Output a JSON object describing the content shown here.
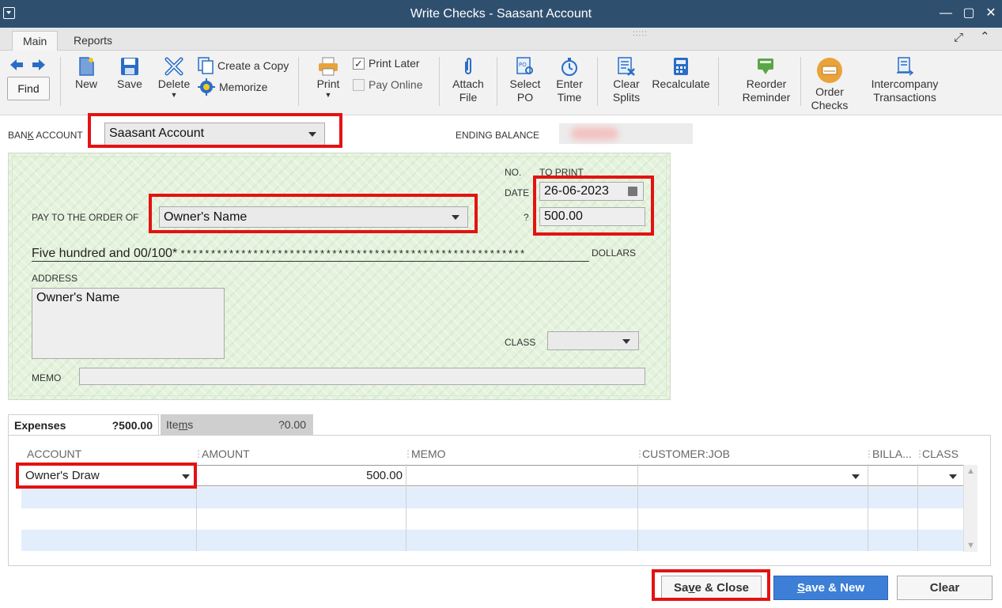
{
  "window": {
    "title": "Write Checks - Saasant Account"
  },
  "tabs": [
    {
      "label": "Main"
    },
    {
      "label": "Reports"
    }
  ],
  "toolbar": {
    "find": "Find",
    "new": "New",
    "save": "Save",
    "delete": "Delete",
    "create_copy": "Create a Copy",
    "memorize": "Memorize",
    "print": "Print",
    "print_later": "Print Later",
    "pay_online": "Pay Online",
    "attach_file": [
      "Attach",
      "File"
    ],
    "select_po": [
      "Select",
      "PO"
    ],
    "enter_time": [
      "Enter",
      "Time"
    ],
    "clear_splits": [
      "Clear",
      "Splits"
    ],
    "recalculate": "Recalculate",
    "reorder_reminder": [
      "Reorder",
      "Reminder"
    ],
    "order_checks": [
      "Order",
      "Checks"
    ],
    "intercompany": [
      "Intercompany",
      "Transactions"
    ]
  },
  "header": {
    "bank_account_label_pre": "BAN",
    "bank_account_label_k": "K",
    "bank_account_label_post": " ACCOUNT",
    "bank_account_value": "Saasant Account",
    "ending_balance_label": "ENDING BALANCE"
  },
  "check": {
    "no_label": "NO.",
    "no_value": "TO PRINT",
    "date_label": "DATE",
    "date_value": "26-06-2023",
    "pay_to_label": "PAY TO THE ORDER OF",
    "pay_to_value": "Owner's Name",
    "amount_label": "?",
    "amount_value": "500.00",
    "amount_words": "Five hundred and 00/100*",
    "amount_stars": "* * * * * * * * * * * * * * * * * * * * * * * * * * * * * * * * * * * * * * * * * * * * * * * * * * * * * * * * *",
    "dollars_label": "DOLLARS",
    "address_label": "ADDRESS",
    "address_value": "Owner's Name",
    "class_label": "CLASS",
    "memo_label": "MEMO"
  },
  "detail_tabs": {
    "expenses_label": "Expenses",
    "expenses_total": "?500.00",
    "items_label_pre": "Ite",
    "items_label_u": "m",
    "items_label_post": "s",
    "items_total": "?0.00"
  },
  "grid": {
    "columns": [
      "ACCOUNT",
      "AMOUNT",
      "MEMO",
      "CUSTOMER:JOB",
      "BILLA...",
      "CLASS"
    ],
    "rows": [
      {
        "account": "Owner's Draw",
        "amount": "500.00"
      }
    ]
  },
  "buttons": {
    "save_close_pre": "Sa",
    "save_close_u": "v",
    "save_close_post": "e & Close",
    "save_new_u": "S",
    "save_new_post": "ave & New",
    "clear": "Clear"
  },
  "colors": {
    "titlebar": "#2f4f6f",
    "highlight": "#e41212",
    "primary_button": "#3d7fd6",
    "check_bg": "#e5f3de"
  }
}
